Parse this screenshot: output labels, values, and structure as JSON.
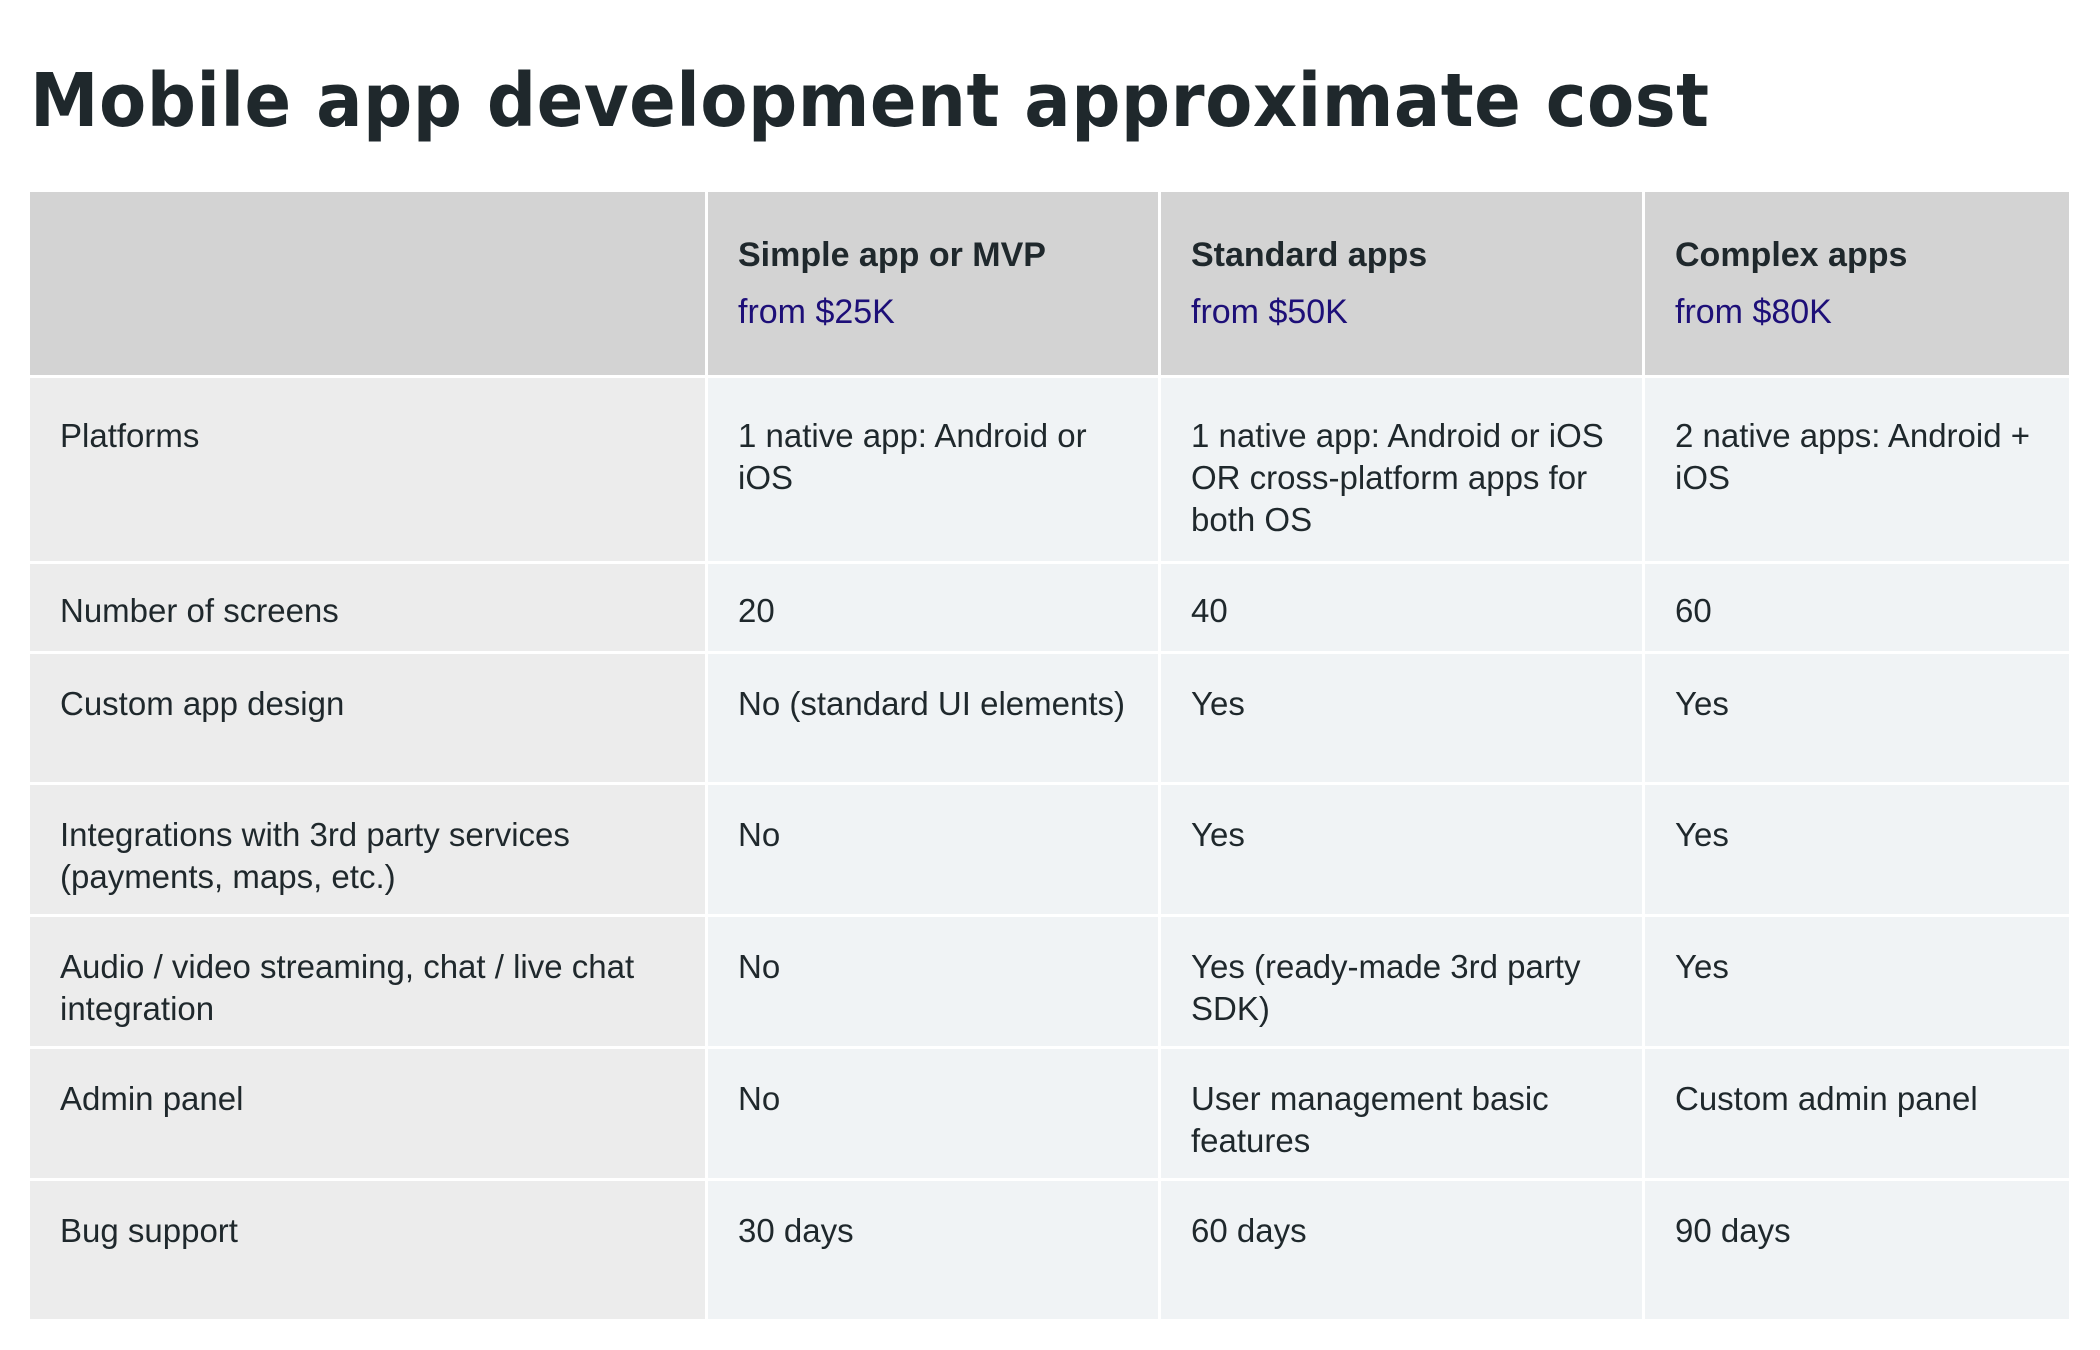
{
  "page": {
    "title": "Mobile app development approximate cost"
  },
  "table": {
    "corner_label": "",
    "plans": [
      {
        "name": "Simple app or MVP",
        "price": "from $25K"
      },
      {
        "name": "Standard apps",
        "price": "from $50K"
      },
      {
        "name": "Complex apps",
        "price": "from $80K"
      }
    ],
    "rows": [
      {
        "label": "Platforms",
        "values": [
          "1 native app: Android or iOS",
          "1 native app: Android or iOS OR cross-platform apps for both OS",
          "2 native apps: Android + iOS"
        ]
      },
      {
        "label": "Number of screens",
        "values": [
          "20",
          "40",
          "60"
        ]
      },
      {
        "label": "Custom app design",
        "values": [
          "No (standard UI elements)",
          "Yes",
          "Yes"
        ]
      },
      {
        "label": "Integrations with 3rd party services (payments, maps, etc.)",
        "values": [
          "No",
          "Yes",
          "Yes"
        ]
      },
      {
        "label": "Audio / video streaming, chat / live chat integration",
        "values": [
          "No",
          "Yes (ready-made 3rd party SDK)",
          "Yes"
        ]
      },
      {
        "label": "Admin panel",
        "values": [
          "No",
          "User management basic features",
          "Custom admin panel"
        ]
      },
      {
        "label": "Bug support",
        "values": [
          "30 days",
          "60 days",
          "90 days"
        ]
      }
    ]
  },
  "colors": {
    "header_bg": "#d3d3d3",
    "label_col_bg": "#ececec",
    "cell_bg": "#f0f3f5",
    "price_text": "#1d0f78",
    "body_text": "#1f282c"
  }
}
